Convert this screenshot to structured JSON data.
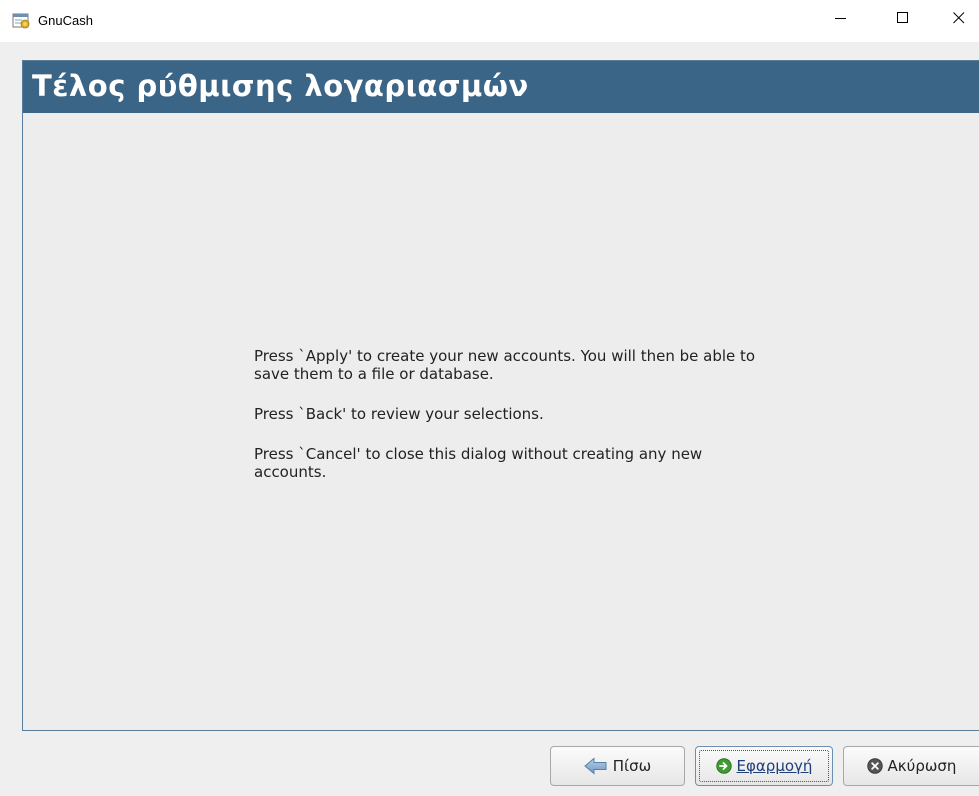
{
  "window": {
    "title": "GnuCash",
    "minimize_icon": "minimize-icon",
    "maximize_icon": "maximize-icon",
    "close_icon": "close-icon"
  },
  "page": {
    "title": "Τέλος ρύθμισης λογαριασμών",
    "header_color": "#3b6587"
  },
  "message": {
    "paragraphs": [
      "Press `Apply' to create your new accounts. You will then be able to save them to a file or database.",
      "Press `Back' to review your selections.",
      "Press `Cancel' to close this dialog without creating any new accounts."
    ]
  },
  "buttons": {
    "back": {
      "label": "Πίσω",
      "icon": "back-arrow-icon"
    },
    "apply": {
      "label": "Εφαρμογή",
      "icon": "apply-icon"
    },
    "cancel": {
      "label": "Ακύρωση",
      "icon": "cancel-icon"
    }
  }
}
